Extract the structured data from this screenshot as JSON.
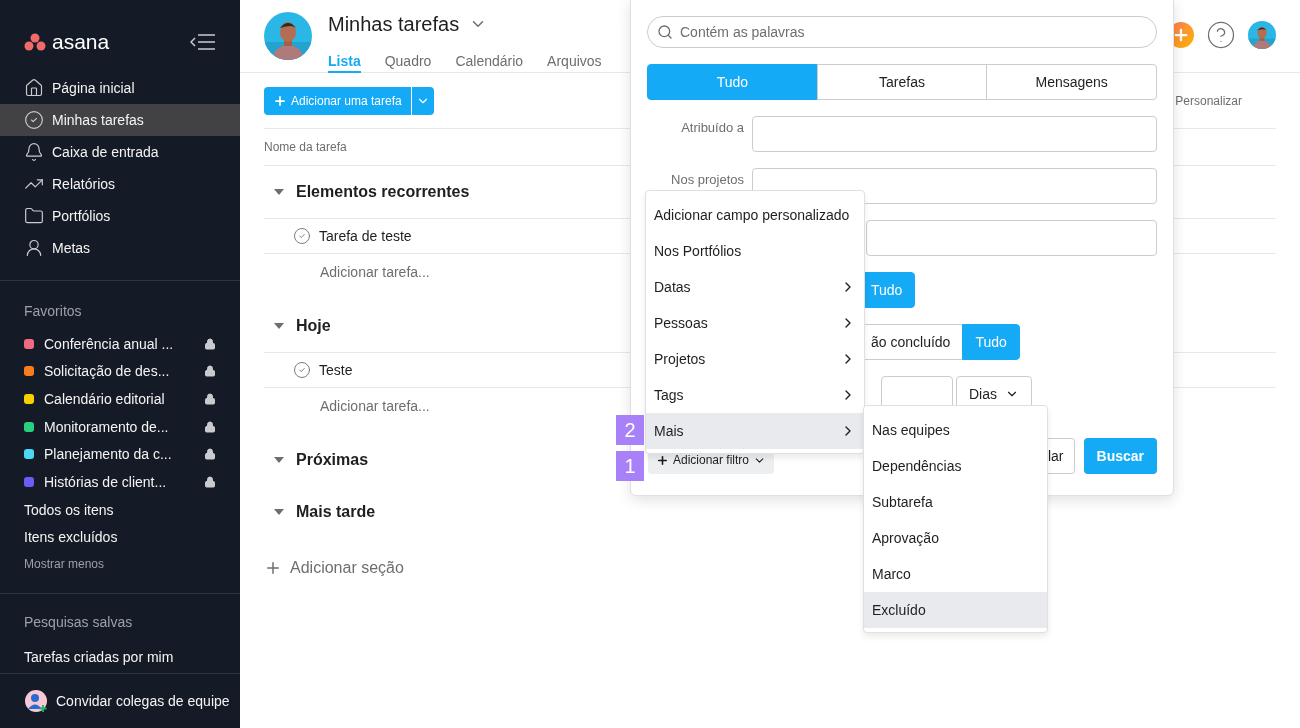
{
  "sidebar": {
    "logo": "asana",
    "nav": [
      {
        "label": "Página inicial",
        "selected": false
      },
      {
        "label": "Minhas tarefas",
        "selected": true
      },
      {
        "label": "Caixa de entrada",
        "selected": false
      },
      {
        "label": "Relatórios",
        "selected": false
      },
      {
        "label": "Portfólios",
        "selected": false
      },
      {
        "label": "Metas",
        "selected": false
      }
    ],
    "favorites_heading": "Favoritos",
    "favorites": [
      {
        "label": "Conferência anual ...",
        "color": "#f06a81",
        "locked": true
      },
      {
        "label": "Solicitação de des...",
        "color": "#f77d1f",
        "locked": true
      },
      {
        "label": "Calendário editorial",
        "color": "#f9d100",
        "locked": true
      },
      {
        "label": "Monitoramento de...",
        "color": "#27d17f",
        "locked": true
      },
      {
        "label": "Planejamento da c...",
        "color": "#4ad8f5",
        "locked": true
      },
      {
        "label": "Histórias de client...",
        "color": "#6e5cf6",
        "locked": true
      }
    ],
    "links": [
      "Todos os itens",
      "Itens excluídos"
    ],
    "show_less": "Mostrar menos",
    "saved_heading": "Pesquisas salvas",
    "saved": [
      "Tarefas criadas por mim"
    ],
    "invite": "Convidar colegas de equipe"
  },
  "header": {
    "title": "Minhas tarefas",
    "tabs": [
      {
        "label": "Lista",
        "selected": true
      },
      {
        "label": "Quadro",
        "selected": false
      },
      {
        "label": "Calendário",
        "selected": false
      },
      {
        "label": "Arquivos",
        "selected": false
      }
    ]
  },
  "toolbar": {
    "add_button": "Adicionar uma tarefa",
    "customize": "Personalizar"
  },
  "table": {
    "column": "Nome da tarefa",
    "sections": [
      {
        "title": "Elementos recorrentes",
        "tasks": [
          "Tarefa de teste"
        ],
        "add_task": "Adicionar tarefa..."
      },
      {
        "title": "Hoje",
        "tasks": [
          "Teste"
        ],
        "add_task": "Adicionar tarefa..."
      },
      {
        "title": "Próximas"
      },
      {
        "title": "Mais tarde"
      }
    ],
    "add_section": "Adicionar seção"
  },
  "search_popover": {
    "placeholder": "Contém as palavras",
    "type_tabs": [
      {
        "label": "Tudo",
        "selected": true
      },
      {
        "label": "Tarefas",
        "selected": false
      },
      {
        "label": "Mensagens",
        "selected": false
      }
    ],
    "rows": [
      {
        "kind": "field",
        "label": "Atribuído a"
      },
      {
        "kind": "field",
        "label": "Nos projetos"
      },
      {
        "kind": "field"
      },
      {
        "kind": "segments",
        "options": [
          {
            "label": "Tudo",
            "selected": true
          }
        ]
      },
      {
        "kind": "segments",
        "options": [
          {
            "label": "ão concluído",
            "selected": false
          },
          {
            "label": "Tudo",
            "selected": true
          }
        ]
      },
      {
        "kind": "range",
        "unit": "Dias"
      }
    ],
    "add_filter": {
      "label": "Adicionar filtro",
      "step": "1"
    },
    "cancel": "lar",
    "search_button": "Buscar"
  },
  "filter_menu": {
    "items": [
      {
        "label": "Adicionar campo personalizado",
        "submenu": false,
        "selected": false
      },
      {
        "label": "Nos Portfólios",
        "submenu": false,
        "selected": false
      },
      {
        "label": "Datas",
        "submenu": true,
        "selected": false
      },
      {
        "label": "Pessoas",
        "submenu": true,
        "selected": false
      },
      {
        "label": "Projetos",
        "submenu": true,
        "selected": false
      },
      {
        "label": "Tags",
        "submenu": true,
        "selected": false
      },
      {
        "label": "Mais",
        "submenu": true,
        "selected": true,
        "step": "2"
      }
    ]
  },
  "submenu": {
    "items": [
      {
        "label": "Nas equipes",
        "selected": false
      },
      {
        "label": "Dependências",
        "selected": false
      },
      {
        "label": "Subtarefa",
        "selected": false
      },
      {
        "label": "Aprovação",
        "selected": false
      },
      {
        "label": "Marco",
        "selected": false
      },
      {
        "label": "Excluído",
        "selected": true
      }
    ]
  }
}
